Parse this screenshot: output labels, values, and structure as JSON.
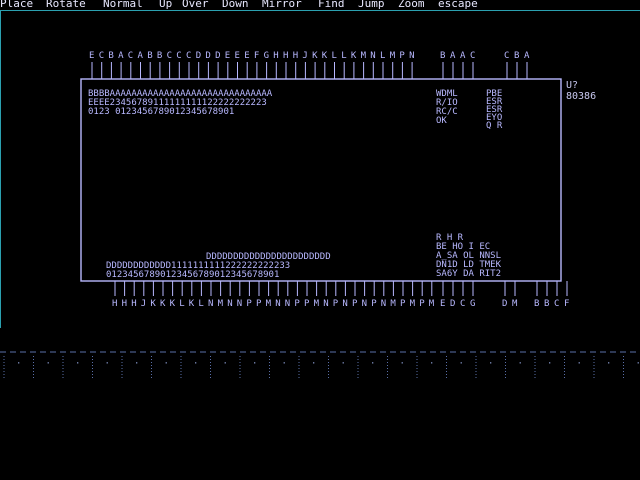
{
  "menu": {
    "items": [
      "Place",
      "Rotate",
      "Normal",
      "Up",
      "Over",
      "Down",
      "Mirror",
      "Find",
      "Jump",
      "Zoom",
      "escape"
    ]
  },
  "component": {
    "reference": "U?",
    "value": "80386",
    "top_pins": [
      "E",
      "C",
      "B",
      "A",
      "C",
      "A",
      "B",
      "B",
      "C",
      "C",
      "C",
      "D",
      "D",
      "D",
      "E",
      "E",
      "E",
      "F",
      "G",
      "H",
      "H",
      "H",
      "J",
      "K",
      "K",
      "L",
      "L",
      "K",
      "M",
      "N",
      "L",
      "M",
      "P",
      "N"
    ],
    "top_pins_right": [
      "B",
      "A",
      "A",
      "C",
      "C",
      "B",
      "A"
    ],
    "inner_top_lines": [
      "BBBBAAAAAAAAAAAAAAAAAAAAAAAAAAAAAA",
      "EEEE23456789111111111122222222223",
      "0123          0123456789012345678901"
    ],
    "inner_signals_right": [
      "WDML",
      "R/IO",
      "RC/C",
      " OK"
    ],
    "inner_signals_far": [
      "PBE",
      "ESR",
      "ESR",
      "EYO",
      "Q R"
    ],
    "inner_bottom_d": "DDDDDDDDDDDDDDDDDDDDDDD",
    "inner_bottom_lines": [
      "DDDDDDDDDDDD1111111111222222222233",
      "01234567890123456789012345678901"
    ],
    "inner_bottom_right": [
      " R  H  R",
      " BE HO I EC",
      "A_SA OL NNSL",
      "DN1D LD TMEK",
      "SA6Y DA RIT2"
    ],
    "bottom_pins": [
      "H",
      "H",
      "H",
      "J",
      "K",
      "K",
      "K",
      "L",
      "K",
      "L",
      "N",
      "M",
      "N",
      "N",
      "P",
      "P",
      "M",
      "N",
      "N",
      "P",
      "P",
      "M",
      "N",
      "P",
      "N",
      "P",
      "N",
      "P",
      "N",
      "M",
      "P",
      "M",
      "P",
      "M"
    ],
    "bottom_pins_right": [
      "E",
      "D",
      "C",
      "G",
      "D",
      "M",
      "B",
      "B",
      "C",
      "F"
    ]
  },
  "colors": {
    "accent_rule": "#2ba0b0",
    "component_line": "#b8b8ff",
    "text": "#c8c8f0",
    "background": "#000000"
  },
  "status": {
    "glyph": "·"
  }
}
